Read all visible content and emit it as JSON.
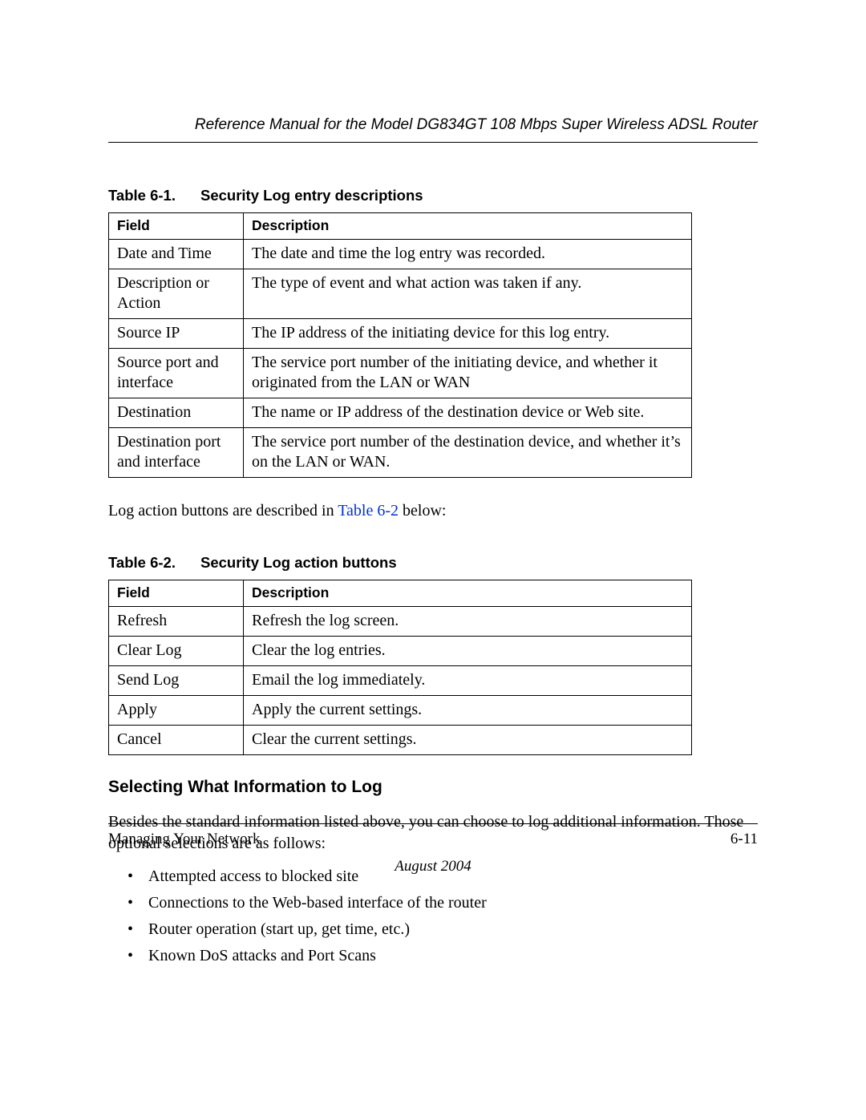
{
  "header": {
    "running_title": "Reference Manual for the Model DG834GT 108 Mbps Super Wireless ADSL Router"
  },
  "table1": {
    "caption_number": "Table 6-1.",
    "caption_title": "Security Log entry descriptions",
    "col_headers": {
      "field": "Field",
      "description": "Description"
    },
    "rows": [
      {
        "field": "Date and Time",
        "description": "The date and time the log entry was recorded."
      },
      {
        "field": "Description or Action",
        "description": "The type of event and what action was taken if any."
      },
      {
        "field": "Source IP",
        "description": "The IP address of the initiating device for this log entry."
      },
      {
        "field": "Source port and interface",
        "description": "The service port number of the initiating device, and whether it originated from the LAN or WAN"
      },
      {
        "field": "Destination",
        "description": "The name or IP address of the destination device or Web site."
      },
      {
        "field": "Destination port and interface",
        "description": "The service port number of the destination device, and whether it’s on the LAN or WAN."
      }
    ]
  },
  "paragraph1": {
    "before_link": "Log action buttons are described in ",
    "link_text": "Table 6-2",
    "after_link": " below:"
  },
  "table2": {
    "caption_number": "Table 6-2.",
    "caption_title": "Security Log action buttons",
    "col_headers": {
      "field": "Field",
      "description": "Description"
    },
    "rows": [
      {
        "field": "Refresh",
        "description": "Refresh the log screen."
      },
      {
        "field": "Clear Log",
        "description": "Clear the log entries."
      },
      {
        "field": "Send Log",
        "description": "Email the log immediately."
      },
      {
        "field": "Apply",
        "description": "Apply the current settings."
      },
      {
        "field": "Cancel",
        "description": "Clear the current settings."
      }
    ]
  },
  "section": {
    "heading": "Selecting What Information to Log",
    "intro": "Besides the standard information listed above, you can choose to log additional information. Those optional selections are as follows:",
    "bullets": [
      "Attempted access to blocked site",
      "Connections to the Web-based interface of the router",
      "Router operation (start up, get time, etc.)",
      "Known DoS attacks and Port Scans"
    ]
  },
  "footer": {
    "section_title": "Managing Your Network",
    "page_number": "6-11",
    "date": "August 2004"
  }
}
